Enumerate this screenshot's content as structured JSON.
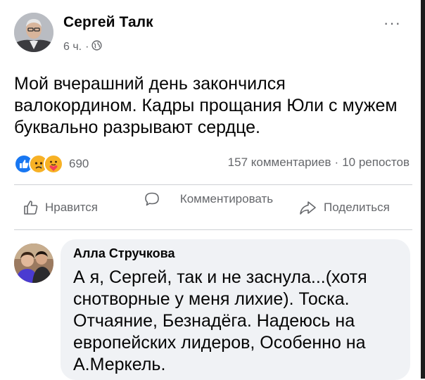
{
  "post": {
    "author": "Сергей Талк",
    "time": "6 ч.",
    "separator": "·",
    "audience_icon": "globe-icon",
    "more_label": "···",
    "text": "Мой вчерашний день закончился валокордином. Кадры прощания Юли с мужем буквально разрывают сердце."
  },
  "reactions": {
    "icons": [
      "like-icon",
      "sad-icon",
      "care-icon"
    ],
    "count": "690",
    "comments": "157 комментариев",
    "separator": "·",
    "shares": "10 репостов"
  },
  "actions": {
    "like": "Нравится",
    "comment": "Комментировать",
    "share": "Поделиться"
  },
  "comment": {
    "author": "Алла Стручкова",
    "text": "А я, Сергей, так и не заснула...(хотя снотворные у меня лихие). Тоска. Отчаяние, Безнадёга. Надеюсь на европейских лидеров, Особенно на А.Меркель."
  },
  "colors": {
    "like_blue": "#1877f2",
    "reaction_yellow": "#f7b125",
    "secondary_text": "#65676b",
    "bubble": "#f0f2f5"
  }
}
